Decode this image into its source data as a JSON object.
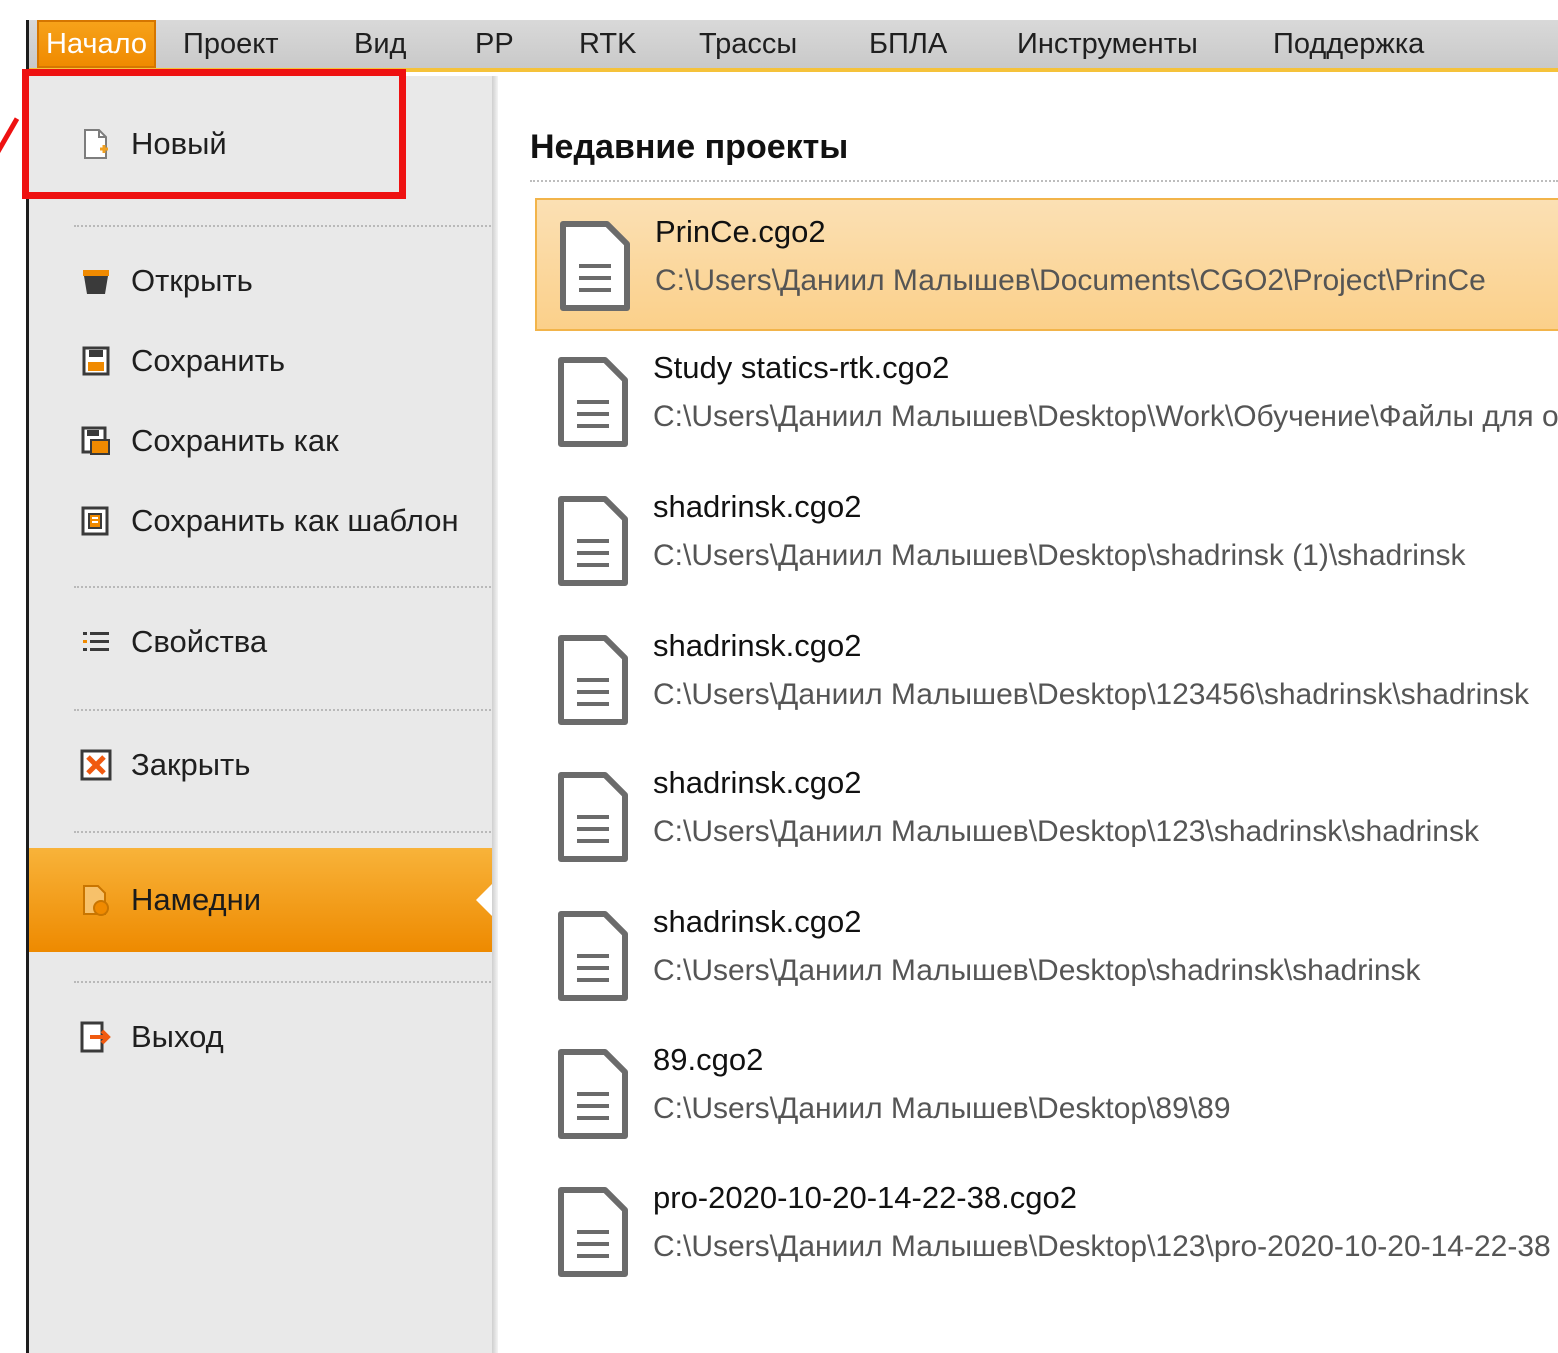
{
  "menubar": {
    "items": [
      {
        "label": "Начало",
        "active": true
      },
      {
        "label": "Проект"
      },
      {
        "label": "Вид"
      },
      {
        "label": "PP"
      },
      {
        "label": "RTK"
      },
      {
        "label": "Трассы"
      },
      {
        "label": "БПЛА"
      },
      {
        "label": "Инструменты"
      },
      {
        "label": "Поддержка"
      }
    ]
  },
  "sidebar": {
    "items": [
      {
        "label": "Новый",
        "icon": "new-file-icon"
      },
      {
        "label": "Открыть",
        "icon": "open-folder-icon"
      },
      {
        "label": "Сохранить",
        "icon": "save-icon"
      },
      {
        "label": "Сохранить как",
        "icon": "save-as-icon"
      },
      {
        "label": "Сохранить как шаблон",
        "icon": "save-template-icon"
      },
      {
        "label": "Свойства",
        "icon": "properties-list-icon"
      },
      {
        "label": "Закрыть",
        "icon": "close-icon"
      },
      {
        "label": "Намедни",
        "icon": "recent-icon",
        "selected": true
      },
      {
        "label": "Выход",
        "icon": "exit-icon"
      }
    ]
  },
  "recent": {
    "title": "Недавние проекты",
    "items": [
      {
        "name": "PrinCe.cgo2",
        "path": "C:\\Users\\Даниил Малышев\\Documents\\CGO2\\Project\\PrinCe"
      },
      {
        "name": "Study statics-rtk.cgo2",
        "path": "C:\\Users\\Даниил Малышев\\Desktop\\Work\\Обучение\\Файлы для об"
      },
      {
        "name": "shadrinsk.cgo2",
        "path": "C:\\Users\\Даниил Малышев\\Desktop\\shadrinsk (1)\\shadrinsk"
      },
      {
        "name": "shadrinsk.cgo2",
        "path": "C:\\Users\\Даниил Малышев\\Desktop\\123456\\shadrinsk\\shadrinsk"
      },
      {
        "name": "shadrinsk.cgo2",
        "path": "C:\\Users\\Даниил Малышев\\Desktop\\123\\shadrinsk\\shadrinsk"
      },
      {
        "name": "shadrinsk.cgo2",
        "path": "C:\\Users\\Даниил Малышев\\Desktop\\shadrinsk\\shadrinsk"
      },
      {
        "name": "89.cgo2",
        "path": "C:\\Users\\Даниил Малышев\\Desktop\\89\\89"
      },
      {
        "name": "pro-2020-10-20-14-22-38.cgo2",
        "path": "C:\\Users\\Даниил Малышев\\Desktop\\123\\pro-2020-10-20-14-22-38"
      }
    ]
  },
  "colors": {
    "accent": "#f08a00",
    "highlight_box": "#ee1111",
    "menubar_underline": "#f5c23a"
  }
}
